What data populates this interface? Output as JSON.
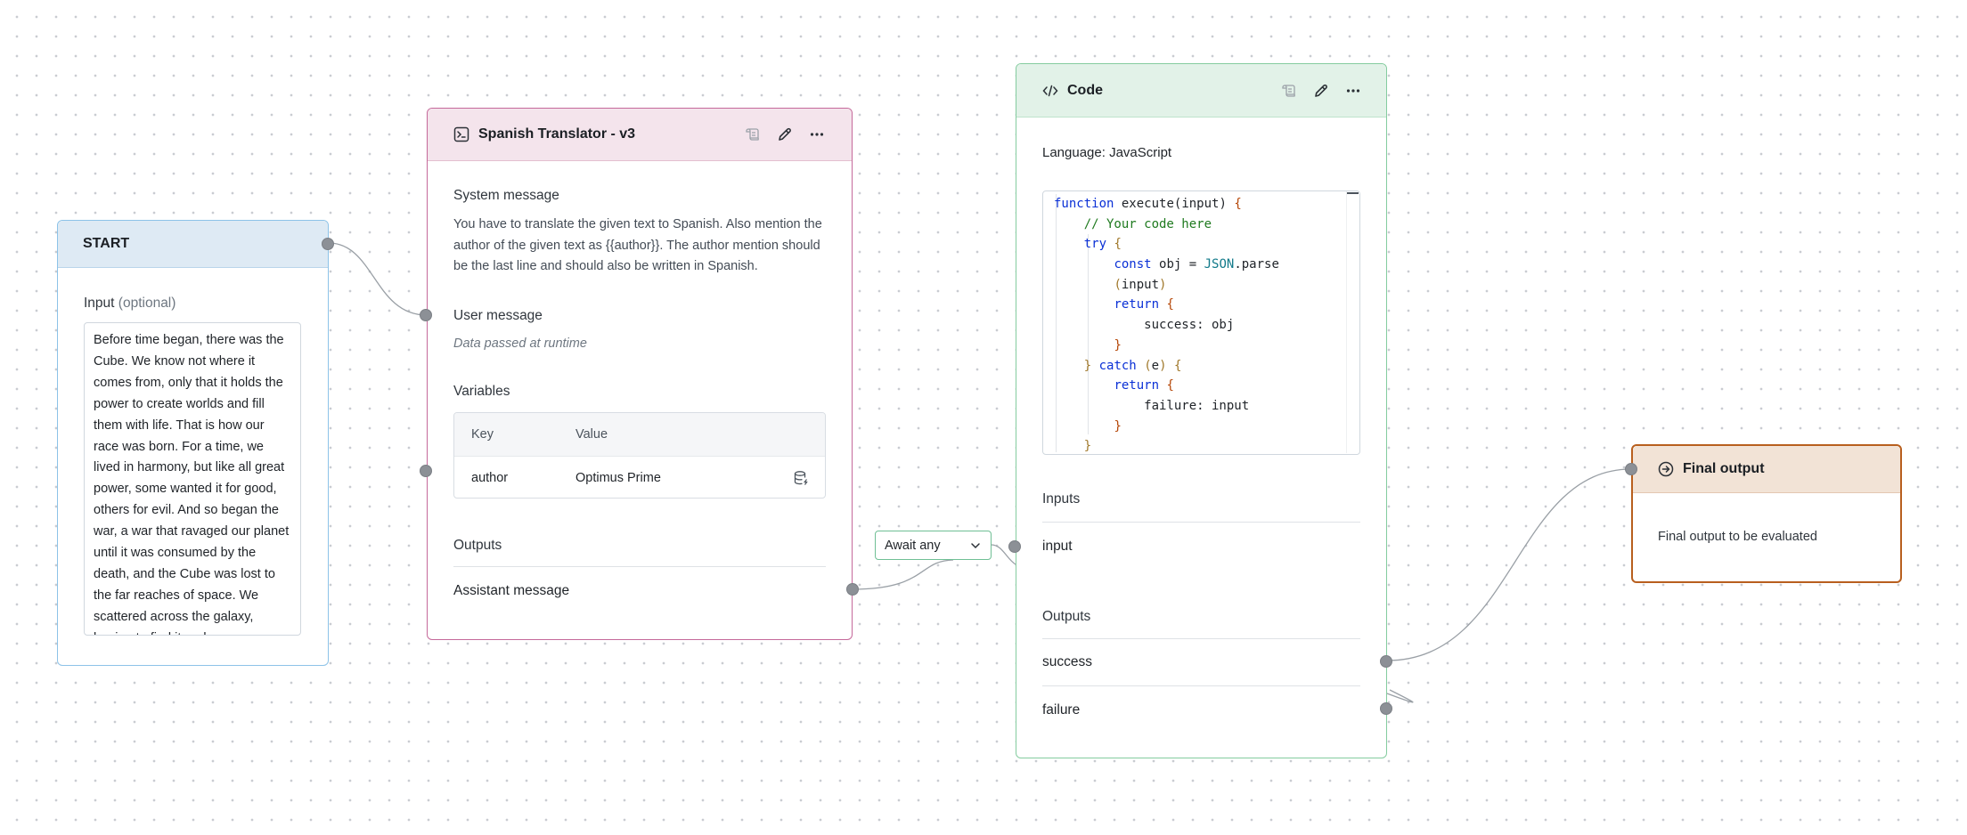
{
  "start": {
    "title": "START",
    "input_label": "Input",
    "input_optional": "(optional)",
    "input_value": "Before time began, there was the Cube. We know not where it comes from, only that it holds the power to create worlds and fill them with life. That is how our race was born. For a time, we lived in harmony, but like all great power, some wanted it for good, others for evil. And so began the war, a war that ravaged our planet until it was consumed by the death, and the Cube was lost to the far reaches of space. We scattered across the galaxy, hoping to find it and"
  },
  "translator": {
    "title": "Spanish Translator - v3",
    "system_label": "System message",
    "system_text": "You have to translate the given text to Spanish. Also mention the author of the given text as {{author}}. The author mention should be the last line and should also be written in Spanish.",
    "user_label": "User message",
    "user_text": "Data passed at runtime",
    "variables_label": "Variables",
    "var_key_header": "Key",
    "var_value_header": "Value",
    "variables": [
      {
        "key": "author",
        "value": "Optimus Prime"
      }
    ],
    "outputs_label": "Outputs",
    "output_item": "Assistant message"
  },
  "await": {
    "label": "Await any"
  },
  "code": {
    "title": "Code",
    "language_label": "Language: JavaScript",
    "code_lines": [
      "function execute(input) {",
      "    // Your code here",
      "    try {",
      "        const obj = JSON.parse",
      "        (input)",
      "        return {",
      "            success: obj",
      "        }",
      "    } catch (e) {",
      "        return {",
      "            failure: input",
      "        }",
      "    }"
    ],
    "inputs_label": "Inputs",
    "input_item": "input",
    "outputs_label": "Outputs",
    "output_success": "success",
    "output_failure": "failure"
  },
  "final": {
    "title": "Final output",
    "body": "Final output to be evaluated"
  },
  "icons": {
    "start": "none",
    "translator": "terminal-icon",
    "code": "code-icon",
    "final": "arrow-circle-right-icon",
    "actions": [
      "scroll-icon",
      "pencil-icon",
      "more-horizontal-icon"
    ],
    "variable_row": "database-icon",
    "await": "chevron-down-icon"
  },
  "colors": {
    "start_accent": "#8dc3e8",
    "translator_accent": "#c5699a",
    "code_accent": "#84cc9f",
    "final_accent": "#b85f1e"
  }
}
